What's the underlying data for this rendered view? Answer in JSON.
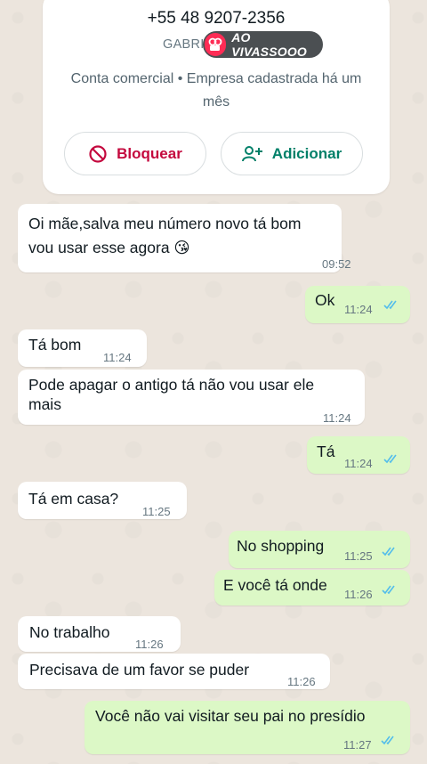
{
  "contact": {
    "phone": "+55 48 9207-2356",
    "name_partial": "GABRIELA PE",
    "business_info": "Conta comercial • Empresa cadastrada há um mês",
    "block_label": "Bloquear",
    "add_label": "Adicionar"
  },
  "live_badge": {
    "label": "AO VIVASSOOO",
    "icon": "live-camera-icon",
    "color": "#fe2c55"
  },
  "colors": {
    "incoming": "#ffffff",
    "outgoing": "#dcf8c6",
    "read_ticks": "#53bdeb",
    "block": "#c4093e",
    "add": "#008069"
  },
  "messages": [
    {
      "dir": "in",
      "lines": [
        "Oi mãe,salva meu número novo tá bom",
        "vou usar esse agora 😘"
      ],
      "time": "09:52"
    },
    {
      "dir": "out",
      "lines": [
        "Ok"
      ],
      "time": "11:24"
    },
    {
      "dir": "in",
      "lines": [
        "Tá bom"
      ],
      "time": "11:24"
    },
    {
      "dir": "in",
      "lines": [
        "Pode apagar o antigo tá não vou usar ele",
        "mais"
      ],
      "time": "11:24"
    },
    {
      "dir": "out",
      "lines": [
        "Tá"
      ],
      "time": "11:24"
    },
    {
      "dir": "in",
      "lines": [
        "Tá em casa?"
      ],
      "time": "11:25"
    },
    {
      "dir": "out",
      "lines": [
        "No shopping"
      ],
      "time": "11:25"
    },
    {
      "dir": "out",
      "lines": [
        "E você tá onde"
      ],
      "time": "11:26"
    },
    {
      "dir": "in",
      "lines": [
        "No trabalho"
      ],
      "time": "11:26"
    },
    {
      "dir": "in",
      "lines": [
        "Precisava de um favor se puder"
      ],
      "time": "11:26"
    },
    {
      "dir": "out",
      "lines": [
        "Você não vai visitar seu pai no presídio"
      ],
      "time": "11:27"
    }
  ]
}
